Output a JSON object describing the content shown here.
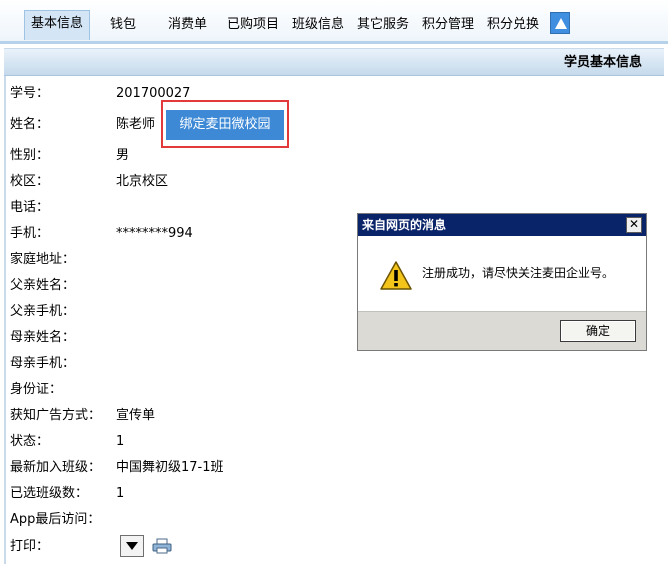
{
  "tabs": [
    {
      "label": "基本信息",
      "active": true
    },
    {
      "label": "钱包"
    },
    {
      "label": "消费单"
    },
    {
      "label": "已购项目"
    },
    {
      "label": "班级信息"
    },
    {
      "label": "其它服务"
    },
    {
      "label": "积分管理"
    },
    {
      "label": "积分兑换"
    }
  ],
  "section": {
    "title": "学员基本信息"
  },
  "fields": [
    {
      "label": "学号：",
      "value": "201700027"
    },
    {
      "label": "姓名：",
      "value": "陈老师"
    },
    {
      "label": "性别：",
      "value": "男"
    },
    {
      "label": "校区：",
      "value": "北京校区"
    },
    {
      "label": "电话：",
      "value": ""
    },
    {
      "label": "手机：",
      "value": "********994"
    },
    {
      "label": "家庭地址：",
      "value": ""
    },
    {
      "label": "父亲姓名：",
      "value": ""
    },
    {
      "label": "父亲手机：",
      "value": ""
    },
    {
      "label": "母亲姓名：",
      "value": ""
    },
    {
      "label": "母亲手机：",
      "value": ""
    },
    {
      "label": "身份证：",
      "value": ""
    },
    {
      "label": "获知广告方式：",
      "value": "宣传单"
    },
    {
      "label": "状态：",
      "value": "1"
    },
    {
      "label": "最新加入班级：",
      "value": "中国舞初级17-1班"
    },
    {
      "label": "已选班级数：",
      "value": "1"
    },
    {
      "label": "App最后访问：",
      "value": ""
    },
    {
      "label": "打印：",
      "value": ""
    }
  ],
  "bind_button": {
    "label": "绑定麦田微校园"
  },
  "dialog": {
    "title": "来自网页的消息",
    "close_glyph": "✕",
    "message": "注册成功，请尽快关注麦田企业号。",
    "ok_label": "确定"
  },
  "colors": {
    "accent": "#3d89d6",
    "highlight": "#e23a3a",
    "dialog_title_bg": "#0a246a"
  }
}
